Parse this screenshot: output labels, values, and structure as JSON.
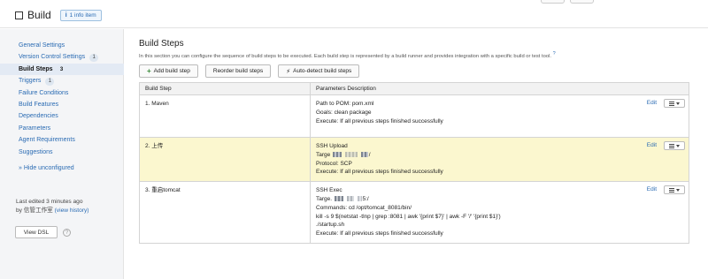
{
  "header": {
    "title": "Build",
    "info_badge": "1 info item",
    "info_icon": "i"
  },
  "sidebar": {
    "items": [
      {
        "label": "General Settings",
        "count": ""
      },
      {
        "label": "Version Control Settings",
        "count": "1"
      },
      {
        "label": "Build Steps",
        "count": "3"
      },
      {
        "label": "Triggers",
        "count": "1"
      },
      {
        "label": "Failure Conditions",
        "count": ""
      },
      {
        "label": "Build Features",
        "count": ""
      },
      {
        "label": "Dependencies",
        "count": ""
      },
      {
        "label": "Parameters",
        "count": ""
      },
      {
        "label": "Agent Requirements",
        "count": ""
      },
      {
        "label": "Suggestions",
        "count": ""
      }
    ],
    "hide_unconfigured": "» Hide unconfigured",
    "last_edited": "Last edited 3 minutes ago",
    "by_prefix": "by 信管工作室",
    "view_history": "(view history)",
    "view_dsl": "View DSL",
    "help_icon": "?"
  },
  "main": {
    "title": "Build Steps",
    "description": "In this section you can configure the sequence of build steps to be executed. Each build step is represented by a build runner and provides integration with a specific build or test tool.",
    "desc_icon": "?",
    "buttons": {
      "add_step": "Add build step",
      "reorder": "Reorder build steps",
      "auto_detect": "Auto-detect build steps"
    },
    "table": {
      "headers": [
        "Build Step",
        "Parameters Description"
      ],
      "edit_label": "Edit",
      "rows": [
        {
          "name": "1. Maven",
          "lines": [
            "Path to POM: pom.xml",
            "Goals: clean package",
            "Execute: If all previous steps finished successfully"
          ]
        },
        {
          "name": "2. 上传",
          "line1": "SSH Upload",
          "target_prefix": "Targe",
          "target_suffix": "/",
          "protocol": "Protocol: SCP",
          "execute": "Execute: If all previous steps finished successfully"
        },
        {
          "name": "3. 重启tomcat",
          "line1": "SSH Exec",
          "target_prefix": "Targe.",
          "target_suffix": "5:/",
          "lines": [
            "Commands: cd /opt/tomcat_8081/bin/",
            "kill -s 9 $(netstat -tlnp | grep :8081 | awk '{print $7}' | awk -F '/' '{print $1}')",
            "./startup.sh",
            "Execute: If all previous steps finished successfully"
          ]
        }
      ]
    }
  },
  "colors": {
    "link": "#2a6bb3",
    "highlight_row": "#fbf7cf",
    "sidebar_bg": "#f4f5f7",
    "active_nav_bg": "#e3eaf4"
  }
}
